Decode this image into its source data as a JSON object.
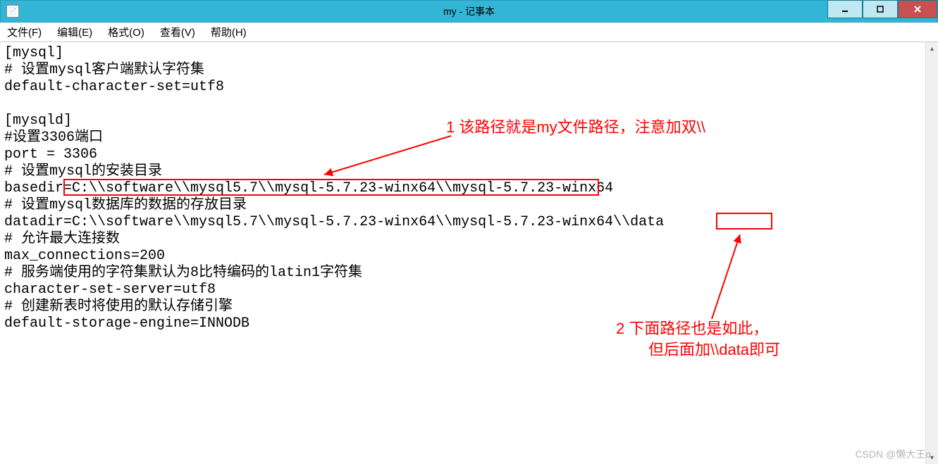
{
  "window": {
    "title": "my - 记事本",
    "icon_glyph": "📄"
  },
  "menu": {
    "file": "文件(F)",
    "edit": "编辑(E)",
    "format": "格式(O)",
    "view": "查看(V)",
    "help": "帮助(H)"
  },
  "content": {
    "l1": "[mysql]",
    "l2": "# 设置mysql客户端默认字符集",
    "l3": "default-character-set=utf8",
    "l4": "",
    "l5": "[mysqld]",
    "l6": "#设置3306端口",
    "l7": "port = 3306",
    "l8": "# 设置mysql的安装目录",
    "l9": "basedir=C:\\\\software\\\\mysql5.7\\\\mysql-5.7.23-winx64\\\\mysql-5.7.23-winx64",
    "l10": "# 设置mysql数据库的数据的存放目录",
    "l11": "datadir=C:\\\\software\\\\mysql5.7\\\\mysql-5.7.23-winx64\\\\mysql-5.7.23-winx64\\\\data",
    "l12": "# 允许最大连接数",
    "l13": "max_connections=200",
    "l14": "# 服务端使用的字符集默认为8比特编码的latin1字符集",
    "l15": "character-set-server=utf8",
    "l16": "# 创建新表时将使用的默认存储引擎",
    "l17": "default-storage-engine=INNODB"
  },
  "annotations": {
    "note1": "1 该路径就是my文件路径，注意加双\\\\",
    "note2_line1": "2 下面路径也是如此，",
    "note2_line2": "但后面加\\\\data即可"
  },
  "watermark": "CSDN @懒大王o"
}
